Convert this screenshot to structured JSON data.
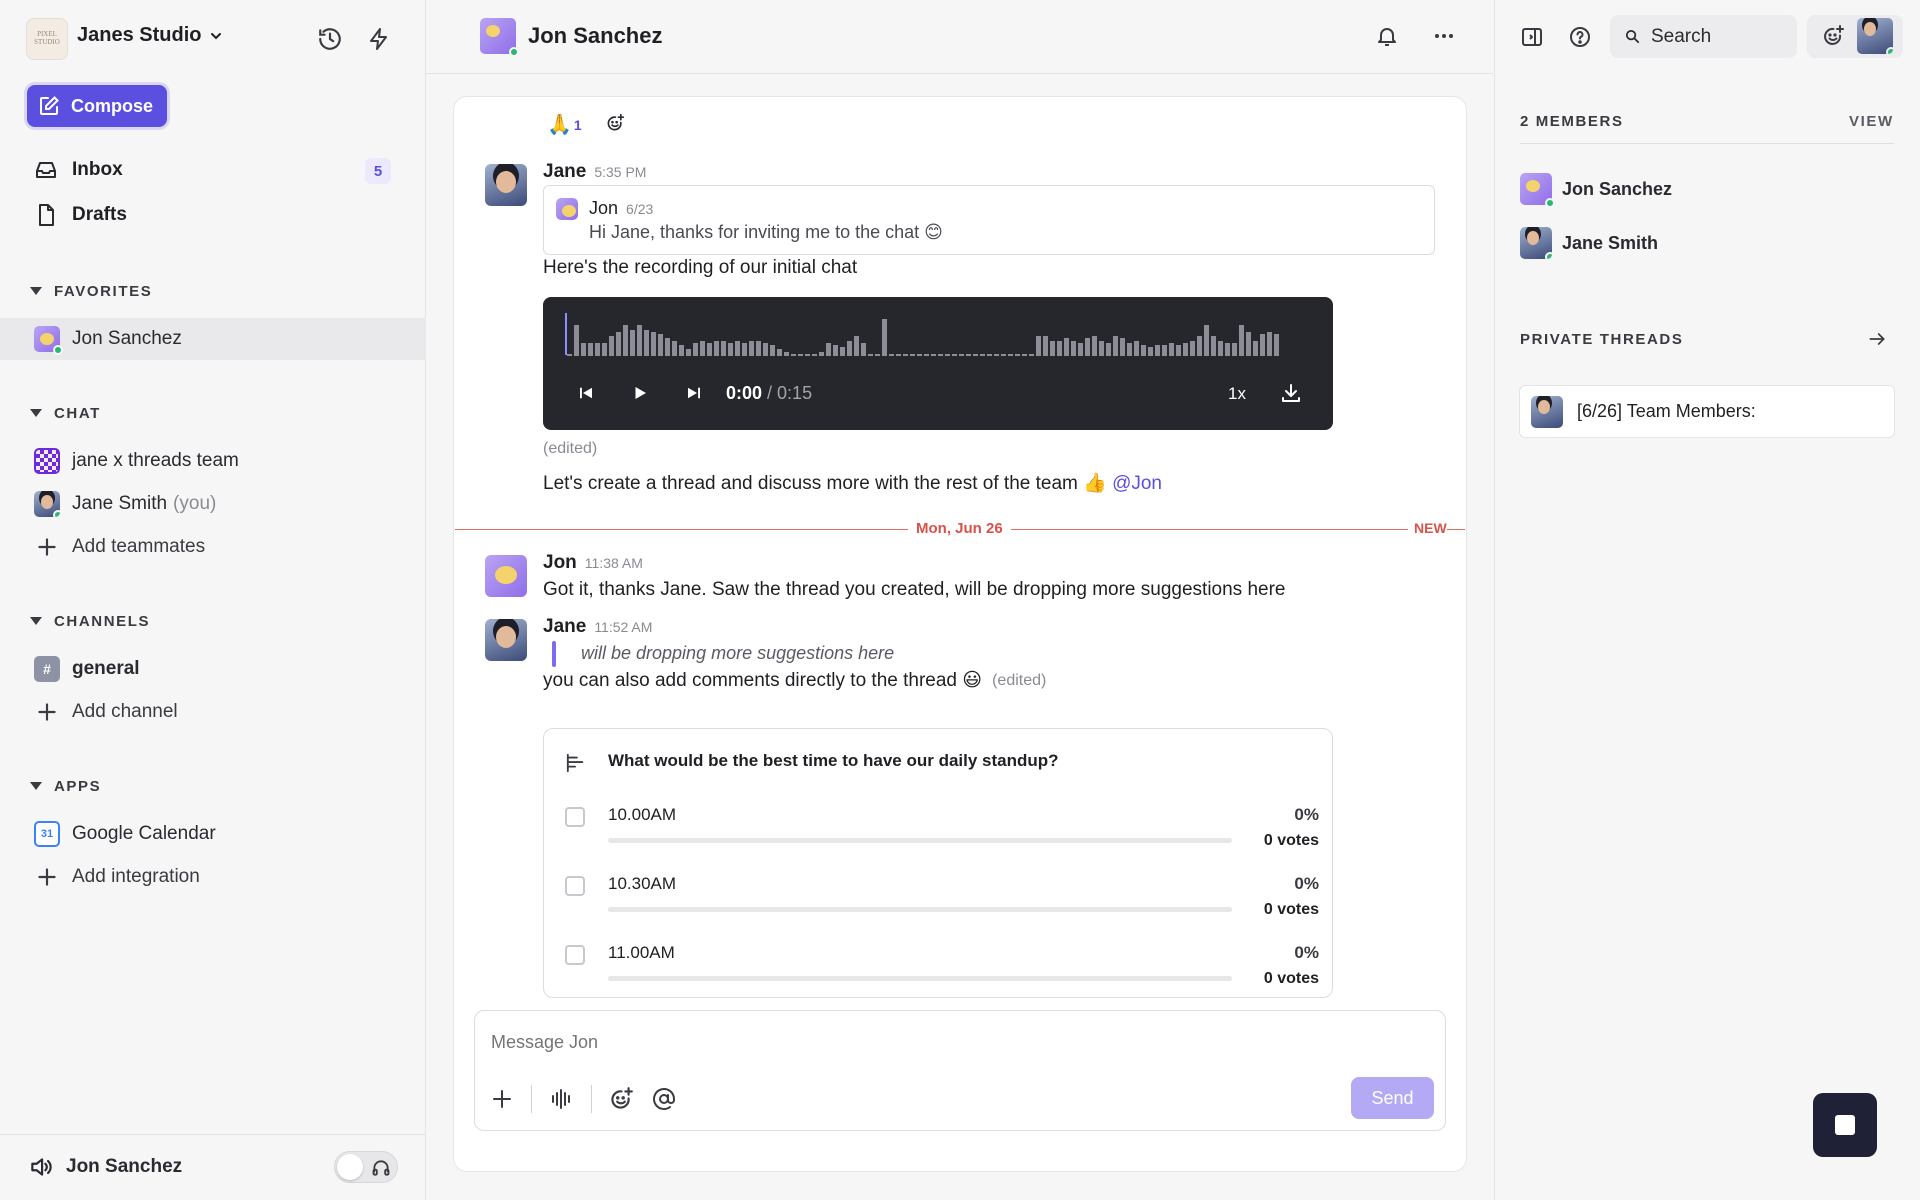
{
  "workspace": {
    "name": "Janes Studio",
    "logo_text": "PIXEL STUDIO"
  },
  "sidebar": {
    "compose_label": "Compose",
    "nav": [
      {
        "label": "Inbox",
        "badge": "5"
      },
      {
        "label": "Drafts"
      }
    ],
    "favorites": {
      "title": "FAVORITES",
      "items": [
        {
          "label": "Jon Sanchez"
        }
      ]
    },
    "chat": {
      "title": "CHAT",
      "items": [
        {
          "label": "jane x threads team"
        },
        {
          "label": "Jane Smith",
          "suffix": "(you)"
        }
      ],
      "add_label": "Add teammates"
    },
    "channels": {
      "title": "CHANNELS",
      "items": [
        {
          "label": "general"
        }
      ],
      "add_label": "Add channel"
    },
    "apps": {
      "title": "APPS",
      "items": [
        {
          "label": "Google Calendar",
          "icon_text": "31"
        }
      ],
      "add_label": "Add integration"
    },
    "footer": {
      "name": "Jon Sanchez"
    }
  },
  "header": {
    "title": "Jon Sanchez"
  },
  "conversation": {
    "reaction": {
      "emoji": "🙏",
      "count": "1"
    },
    "msg1": {
      "author": "Jane",
      "time": "5:35 PM",
      "quote": {
        "author": "Jon",
        "date": "6/23",
        "text": "Hi Jane, thanks for inviting me to the chat 😊"
      },
      "text": "Here's the recording of our initial chat",
      "voice": {
        "current": "0:00",
        "total": "/ 0:15",
        "speed": "1x"
      },
      "edited": "(edited)",
      "text2": "Let's create a thread and discuss more with the rest of the team 👍",
      "mention": "@Jon"
    },
    "divider": {
      "date": "Mon, Jun 26",
      "new": "NEW"
    },
    "msg2": {
      "author": "Jon",
      "time": "11:38 AM",
      "text": "Got it, thanks Jane. Saw the thread you created, will be dropping more suggestions here"
    },
    "msg3": {
      "author": "Jane",
      "time": "11:52 AM",
      "blockquote": "will be dropping more suggestions here",
      "text": "you can also add comments directly to the thread 😃",
      "edited": "(edited)"
    },
    "poll": {
      "question": "What would be the best time to have our daily standup?",
      "options": [
        {
          "label": "10.00AM",
          "percent": "0%",
          "votes": "0 votes",
          "fraction": 0
        },
        {
          "label": "10.30AM",
          "percent": "0%",
          "votes": "0 votes",
          "fraction": 0
        },
        {
          "label": "11.00AM",
          "percent": "0%",
          "votes": "0 votes",
          "fraction": 0
        }
      ]
    }
  },
  "composer": {
    "placeholder": "Message Jon",
    "send_label": "Send"
  },
  "rightpanel": {
    "search_label": "Search",
    "members": {
      "title": "2 MEMBERS",
      "view_label": "VIEW",
      "items": [
        {
          "name": "Jon Sanchez"
        },
        {
          "name": "Jane Smith"
        }
      ]
    },
    "threads": {
      "title": "PRIVATE THREADS",
      "items": [
        {
          "label": "[6/26] Team Members:"
        }
      ]
    }
  },
  "colors": {
    "accent": "#5b4fe0",
    "online": "#2bb673",
    "new_divider": "#d9524b",
    "voice_bg": "#26272c"
  },
  "waveform": [
    0,
    0.7,
    0.3,
    0.3,
    0.3,
    0.3,
    0.45,
    0.55,
    0.7,
    0.6,
    0.7,
    0.6,
    0.55,
    0.5,
    0.4,
    0.35,
    0.25,
    0.15,
    0.3,
    0.35,
    0.3,
    0.35,
    0.35,
    0.3,
    0.35,
    0.3,
    0.35,
    0.35,
    0.3,
    0.25,
    0.15,
    0.1,
    0.05,
    0.05,
    0.05,
    0.05,
    0.1,
    0.3,
    0.25,
    0.2,
    0.35,
    0.45,
    0.3,
    0.05,
    0.05,
    0.85,
    0.05,
    0.05,
    0.05,
    0.05,
    0.05,
    0.05,
    0.05,
    0.05,
    0.05,
    0.05,
    0.05,
    0.05,
    0.05,
    0.05,
    0.05,
    0.05,
    0.05,
    0.05,
    0.05,
    0.05,
    0.05,
    0.45,
    0.45,
    0.35,
    0.35,
    0.4,
    0.35,
    0.3,
    0.4,
    0.45,
    0.35,
    0.3,
    0.45,
    0.4,
    0.3,
    0.35,
    0.25,
    0.2,
    0.25,
    0.25,
    0.3,
    0.25,
    0.3,
    0.35,
    0.45,
    0.7,
    0.45,
    0.35,
    0.3,
    0.3,
    0.7,
    0.55,
    0.35,
    0.5,
    0.55,
    0.5
  ]
}
